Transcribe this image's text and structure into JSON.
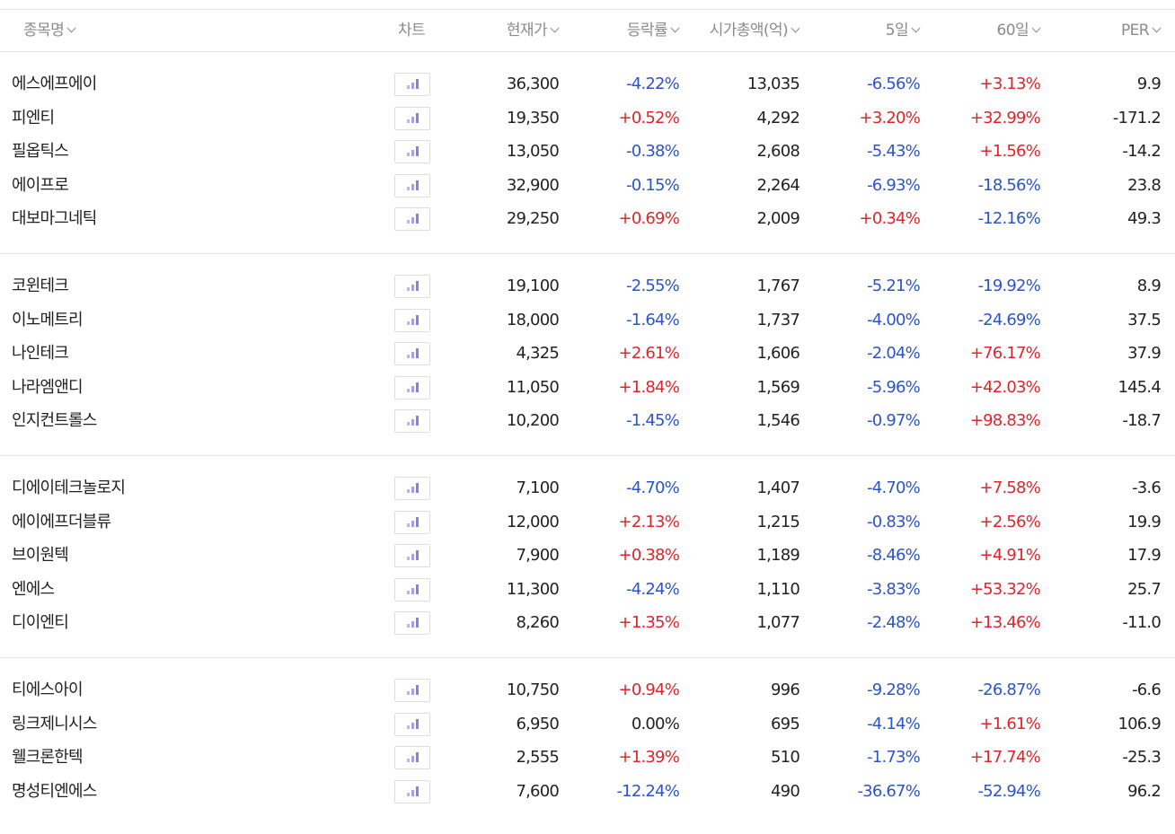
{
  "header": {
    "name": "종목명",
    "chart": "차트",
    "price": "현재가",
    "change": "등락률",
    "market_cap": "시가총액(억)",
    "d5": "5일",
    "d60": "60일",
    "per": "PER"
  },
  "colors": {
    "up": "#e0242a",
    "down": "#2b55c8",
    "header_text": "#8b8b8b",
    "chart_icon": "#8e8fe8"
  },
  "icons": {
    "sort": "chevron-down-icon",
    "chart": "bar-chart-icon"
  },
  "groups": [
    {
      "rows": [
        {
          "name": "에스에프에이",
          "price": "36,300",
          "change": "-4.22%",
          "cap": "13,035",
          "d5": "-6.56%",
          "d60": "+3.13%",
          "per": "9.9"
        },
        {
          "name": "피엔티",
          "price": "19,350",
          "change": "+0.52%",
          "cap": "4,292",
          "d5": "+3.20%",
          "d60": "+32.99%",
          "per": "-171.2"
        },
        {
          "name": "필옵틱스",
          "price": "13,050",
          "change": "-0.38%",
          "cap": "2,608",
          "d5": "-5.43%",
          "d60": "+1.56%",
          "per": "-14.2"
        },
        {
          "name": "에이프로",
          "price": "32,900",
          "change": "-0.15%",
          "cap": "2,264",
          "d5": "-6.93%",
          "d60": "-18.56%",
          "per": "23.8"
        },
        {
          "name": "대보마그네틱",
          "price": "29,250",
          "change": "+0.69%",
          "cap": "2,009",
          "d5": "+0.34%",
          "d60": "-12.16%",
          "per": "49.3"
        }
      ]
    },
    {
      "rows": [
        {
          "name": "코윈테크",
          "price": "19,100",
          "change": "-2.55%",
          "cap": "1,767",
          "d5": "-5.21%",
          "d60": "-19.92%",
          "per": "8.9"
        },
        {
          "name": "이노메트리",
          "price": "18,000",
          "change": "-1.64%",
          "cap": "1,737",
          "d5": "-4.00%",
          "d60": "-24.69%",
          "per": "37.5"
        },
        {
          "name": "나인테크",
          "price": "4,325",
          "change": "+2.61%",
          "cap": "1,606",
          "d5": "-2.04%",
          "d60": "+76.17%",
          "per": "37.9"
        },
        {
          "name": "나라엠앤디",
          "price": "11,050",
          "change": "+1.84%",
          "cap": "1,569",
          "d5": "-5.96%",
          "d60": "+42.03%",
          "per": "145.4"
        },
        {
          "name": "인지컨트롤스",
          "price": "10,200",
          "change": "-1.45%",
          "cap": "1,546",
          "d5": "-0.97%",
          "d60": "+98.83%",
          "per": "-18.7"
        }
      ]
    },
    {
      "rows": [
        {
          "name": "디에이테크놀로지",
          "price": "7,100",
          "change": "-4.70%",
          "cap": "1,407",
          "d5": "-4.70%",
          "d60": "+7.58%",
          "per": "-3.6"
        },
        {
          "name": "에이에프더블류",
          "price": "12,000",
          "change": "+2.13%",
          "cap": "1,215",
          "d5": "-0.83%",
          "d60": "+2.56%",
          "per": "19.9"
        },
        {
          "name": "브이원텍",
          "price": "7,900",
          "change": "+0.38%",
          "cap": "1,189",
          "d5": "-8.46%",
          "d60": "+4.91%",
          "per": "17.9"
        },
        {
          "name": "엔에스",
          "price": "11,300",
          "change": "-4.24%",
          "cap": "1,110",
          "d5": "-3.83%",
          "d60": "+53.32%",
          "per": "25.7"
        },
        {
          "name": "디이엔티",
          "price": "8,260",
          "change": "+1.35%",
          "cap": "1,077",
          "d5": "-2.48%",
          "d60": "+13.46%",
          "per": "-11.0"
        }
      ]
    },
    {
      "rows": [
        {
          "name": "티에스아이",
          "price": "10,750",
          "change": "+0.94%",
          "cap": "996",
          "d5": "-9.28%",
          "d60": "-26.87%",
          "per": "-6.6"
        },
        {
          "name": "링크제니시스",
          "price": "6,950",
          "change": "0.00%",
          "cap": "695",
          "d5": "-4.14%",
          "d60": "+1.61%",
          "per": "106.9"
        },
        {
          "name": "웰크론한텍",
          "price": "2,555",
          "change": "+1.39%",
          "cap": "510",
          "d5": "-1.73%",
          "d60": "+17.74%",
          "per": "-25.3"
        },
        {
          "name": "명성티엔에스",
          "price": "7,600",
          "change": "-12.24%",
          "cap": "490",
          "d5": "-36.67%",
          "d60": "-52.94%",
          "per": "96.2"
        }
      ]
    }
  ]
}
